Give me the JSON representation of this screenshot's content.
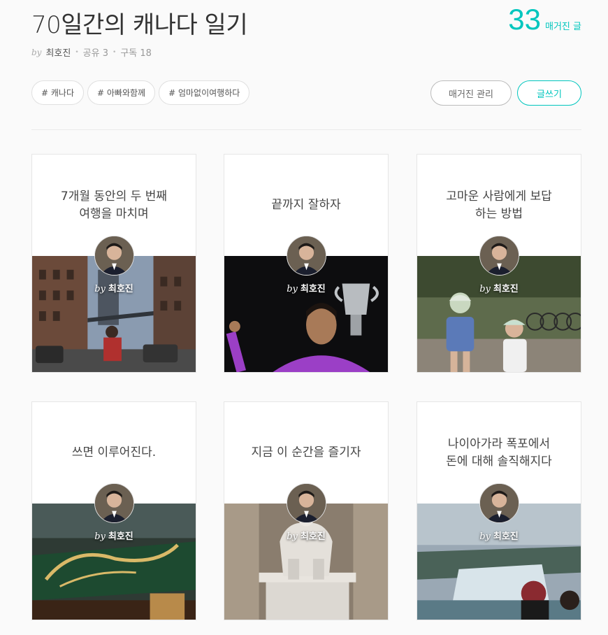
{
  "header": {
    "title": "70일간의 캐나다 일기",
    "count": "33",
    "count_label": "매거진 글",
    "by": "by",
    "author": "최호진",
    "share": "공유 3",
    "subscribe": "구독 18",
    "separator": "•"
  },
  "tags": [
    "# 캐나다",
    "# 아빠와함께",
    "# 엄마없이여행하다"
  ],
  "buttons": {
    "manage": "매거진 관리",
    "write": "글쓰기"
  },
  "colors": {
    "accent": "#00c6be"
  },
  "cards": [
    {
      "title": "7개월 동안의 두 번째\n여행을 마치며",
      "by": "by",
      "author": "최호진",
      "image": "brooklyn-bridge-street-photo"
    },
    {
      "title": "끝까지 잘하자",
      "by": "by",
      "author": "최호진",
      "image": "tennis-trophy-photo"
    },
    {
      "title": "고마운 사람에게 보답\n하는 방법",
      "by": "by",
      "author": "최호진",
      "image": "kids-with-helmets-photo"
    },
    {
      "title": "쓰면 이루어진다.",
      "by": "by",
      "author": "최호진",
      "image": "bagel-shop-sign-photo"
    },
    {
      "title": "지금 이 순간을 즐기자",
      "by": "by",
      "author": "최호진",
      "image": "lincoln-memorial-statue-photo"
    },
    {
      "title": "나이아가라 폭포에서\n돈에 대해 솔직해지다",
      "by": "by",
      "author": "최호진",
      "image": "niagara-falls-photo"
    }
  ]
}
